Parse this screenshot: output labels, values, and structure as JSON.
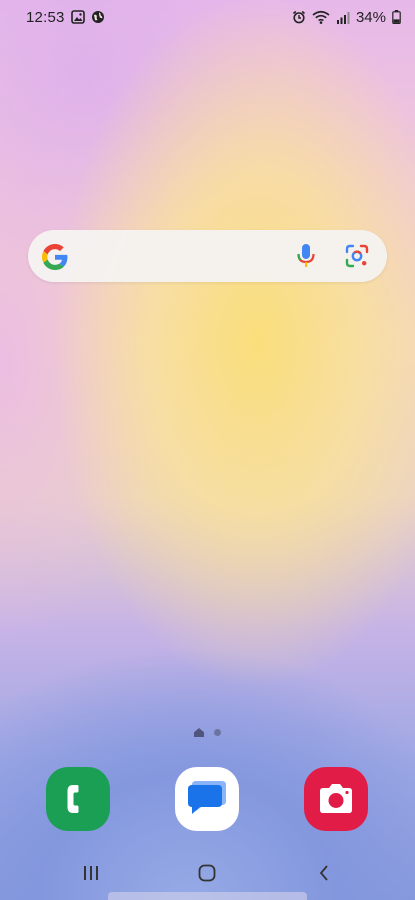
{
  "status_bar": {
    "time": "12:53",
    "battery": "34%",
    "left_icons": [
      "gallery-icon",
      "globe-icon"
    ],
    "right_icons": [
      "alarm-icon",
      "wifi-icon",
      "signal-icon",
      "battery-icon"
    ]
  },
  "search_widget": {
    "icons": [
      "google-logo-icon",
      "mic-icon",
      "google-lens-icon"
    ],
    "colors": {
      "blue": "#4285F4",
      "red": "#EA4335",
      "yellow": "#FBBC05",
      "green": "#34A853"
    }
  },
  "page_indicator": {
    "pages": 2,
    "current": 1
  },
  "dock": {
    "apps": [
      {
        "name": "phone",
        "icon": "phone-icon",
        "color": "#1a9f55"
      },
      {
        "name": "messages",
        "icon": "messages-icon",
        "color": "#ffffff"
      },
      {
        "name": "camera",
        "icon": "camera-icon",
        "color": "#e11d47"
      }
    ]
  },
  "nav_bar": {
    "buttons": [
      "recents-icon",
      "home-icon",
      "back-icon"
    ]
  }
}
